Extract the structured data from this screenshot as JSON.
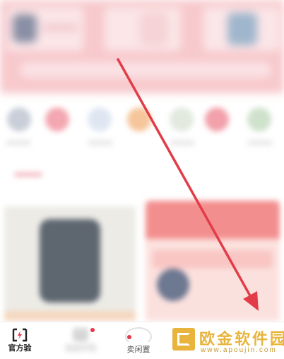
{
  "nav": {
    "items": [
      {
        "label": "官方验",
        "icon": "official-verify-icon"
      },
      {
        "label": "自由市场",
        "icon": "market-icon"
      },
      {
        "label": "卖闲置",
        "icon": "sell-idle-icon"
      }
    ]
  },
  "watermark": {
    "logo_text": "欧金软件园",
    "url": "www.apoujin.com"
  },
  "colors": {
    "accent_red": "#e8354a",
    "arrow_red": "#e23c48",
    "watermark_gold": "#e8b43c"
  }
}
